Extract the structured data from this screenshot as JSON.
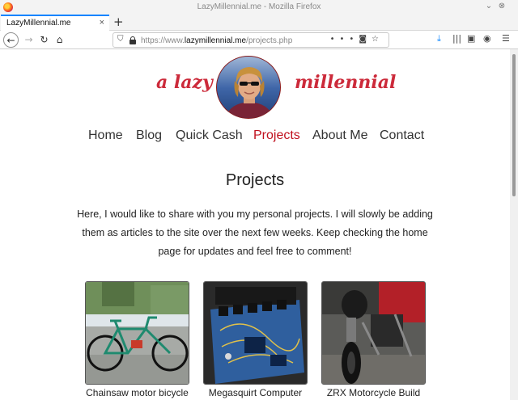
{
  "window": {
    "title": "LazyMillennial.me - Mozilla Firefox"
  },
  "tab": {
    "label": "LazyMillennial.me",
    "close": "×"
  },
  "new_tab": "+",
  "url": {
    "prefix": "https://www.",
    "host": "lazymillennial.me",
    "path": "/projects.php"
  },
  "toolbar_icons": [
    "back-icon",
    "forward-icon",
    "reload-icon",
    "home-icon",
    "shield-icon",
    "lock-icon",
    "more-icon",
    "pocket-icon",
    "bookmark-star-icon",
    "download-icon",
    "library-icon",
    "sidebar-icon",
    "account-icon",
    "menu-icon"
  ],
  "brand": {
    "left": "a lazy",
    "right": "millennial"
  },
  "nav": [
    {
      "label": "Home"
    },
    {
      "label": "Blog"
    },
    {
      "label": "Quick Cash"
    },
    {
      "label": "Projects",
      "active": true
    },
    {
      "label": "About Me"
    },
    {
      "label": "Contact"
    }
  ],
  "page": {
    "title": "Projects",
    "intro": "Here, I would like to share with you my personal projects. I will slowly be adding them as articles to the site over the next few weeks. Keep checking the home page for updates and feel free to comment!"
  },
  "projects": [
    {
      "caption": "Chainsaw motor bicycle"
    },
    {
      "caption": "Megasquirt Computer"
    },
    {
      "caption": "ZRX Motorcycle Build"
    }
  ],
  "colors": {
    "brand": "#cc2a3a",
    "active_nav": "#c0101e",
    "accent": "#0a84ff"
  }
}
